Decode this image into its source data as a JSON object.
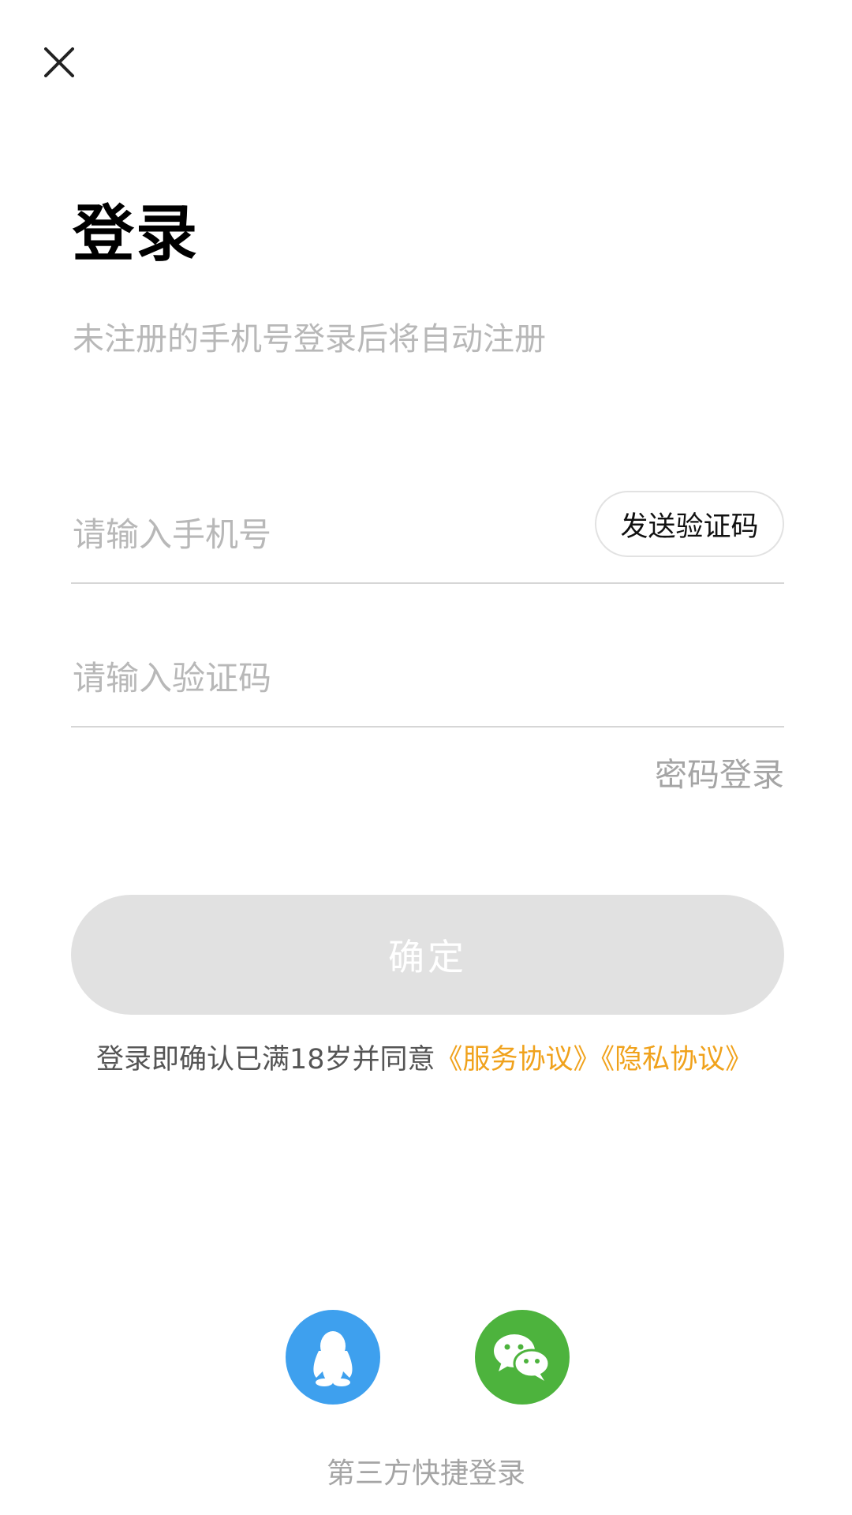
{
  "header": {
    "close_icon": "close-icon"
  },
  "login": {
    "title": "登录",
    "subtitle": "未注册的手机号登录后将自动注册"
  },
  "form": {
    "phone_placeholder": "请输入手机号",
    "phone_value": "",
    "send_code_label": "发送验证码",
    "code_placeholder": "请输入验证码",
    "code_value": "",
    "password_login_label": "密码登录",
    "confirm_label": "确定"
  },
  "agreement": {
    "prefix": "登录即确认已满18岁并同意",
    "service_link": "《服务协议》",
    "privacy_link": "《隐私协议》"
  },
  "third_party": {
    "qq_icon": "qq-icon",
    "wechat_icon": "wechat-icon",
    "caption": "第三方快捷登录"
  },
  "colors": {
    "accent": "#f0a21c",
    "qq": "#3ea0ee",
    "wechat": "#4db33d",
    "button_disabled": "#e1e1e1",
    "placeholder": "#b8b8b8"
  }
}
